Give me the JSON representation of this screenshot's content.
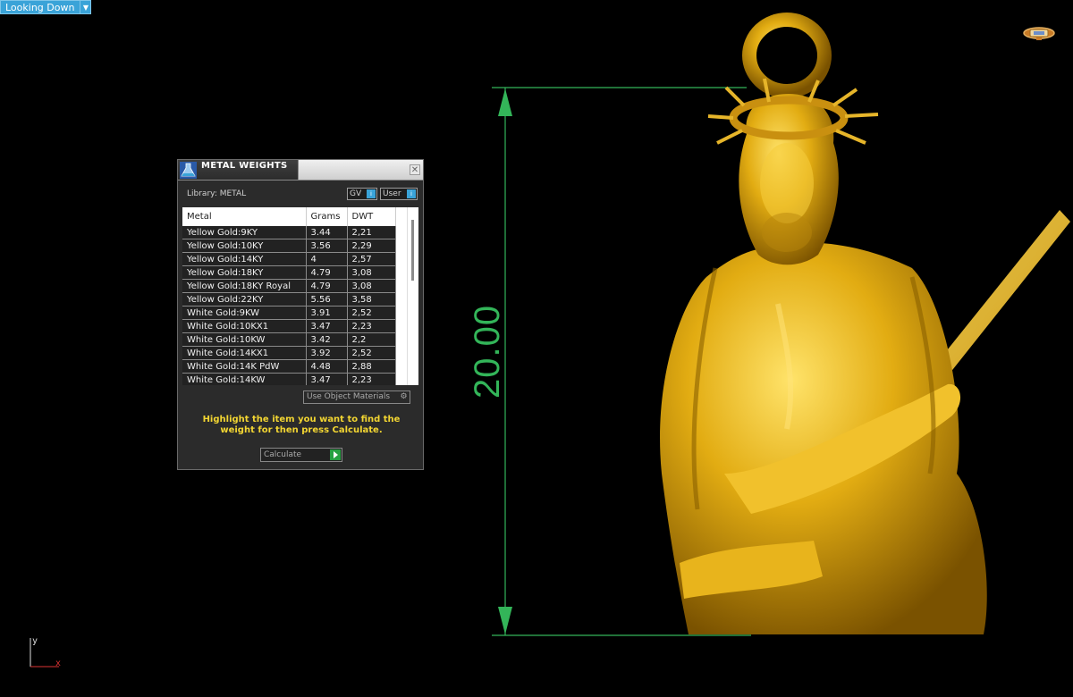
{
  "viewport": {
    "view_label": "Looking Down",
    "dimension_value": "20.00",
    "axis": {
      "y_label": "y",
      "x_label": "x"
    },
    "colors": {
      "background": "#000000",
      "dimension": "#33b559",
      "model_gold": "#d8a010"
    }
  },
  "panel": {
    "title": "METAL WEIGHTS",
    "library_label": "Library: METAL",
    "gv_label": "GV",
    "user_label": "User",
    "columns": [
      "Metal",
      "Grams",
      "DWT"
    ],
    "rows": [
      {
        "metal": "Yellow Gold:9KY",
        "grams": "3.44",
        "dwt": "2,21"
      },
      {
        "metal": "Yellow Gold:10KY",
        "grams": "3.56",
        "dwt": "2,29"
      },
      {
        "metal": "Yellow Gold:14KY",
        "grams": "4",
        "dwt": "2,57"
      },
      {
        "metal": "Yellow Gold:18KY",
        "grams": "4.79",
        "dwt": "3,08"
      },
      {
        "metal": "Yellow Gold:18KY Royal",
        "grams": "4.79",
        "dwt": "3,08"
      },
      {
        "metal": "Yellow Gold:22KY",
        "grams": "5.56",
        "dwt": "3,58"
      },
      {
        "metal": "White Gold:9KW",
        "grams": "3.91",
        "dwt": "2,52"
      },
      {
        "metal": "White Gold:10KX1",
        "grams": "3.47",
        "dwt": "2,23"
      },
      {
        "metal": "White Gold:10KW",
        "grams": "3.42",
        "dwt": "2,2"
      },
      {
        "metal": "White Gold:14KX1",
        "grams": "3.92",
        "dwt": "2,52"
      },
      {
        "metal": "White Gold:14K PdW",
        "grams": "4.48",
        "dwt": "2,88"
      },
      {
        "metal": "White Gold:14KW",
        "grams": "3.47",
        "dwt": "2,23"
      }
    ],
    "use_object_materials": "Use Object Materials",
    "hint": "Highlight the item you want to find the weight for then press Calculate.",
    "calculate_label": "Calculate",
    "icons": {
      "title": "metal-flask-icon",
      "close": "close-icon",
      "gv": "info-icon",
      "user": "info-icon",
      "use_obj": "gear-icon",
      "calculate": "play-arrow-icon"
    }
  }
}
